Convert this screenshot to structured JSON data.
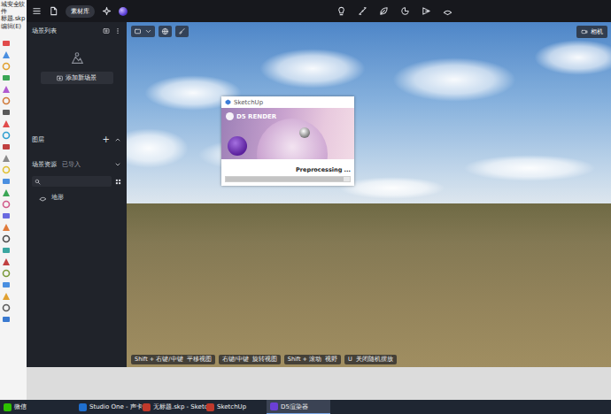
{
  "sketchup": {
    "title_lines": [
      "城安全软",
      "件",
      "标题.skp",
      "编辑(E)"
    ]
  },
  "d5": {
    "toolbar": {
      "library": "素材库"
    },
    "panel": {
      "scenes_title": "场景列表",
      "add_scene": "添加新场景",
      "layers_title": "图层",
      "layers_add": "+",
      "assets_title": "场景资源",
      "assets_filter": "已导入",
      "assets": [
        {
          "label": "地形"
        }
      ]
    },
    "viewport": {
      "camera": "相机",
      "hints": [
        {
          "key": "Shift + 右键/中键",
          "action": "平移视图"
        },
        {
          "key": "右键/中键",
          "action": "旋转视图"
        },
        {
          "key": "Shift + 滚动",
          "action": "视野"
        },
        {
          "key": "U",
          "action": "关闭随机摆放"
        }
      ]
    }
  },
  "splash": {
    "title": "SketchUp",
    "logo": "D5 RENDER",
    "status": "Preprocessing ...",
    "level": 0.95
  },
  "taskbar": {
    "items": [
      {
        "label": "微信",
        "selected": false
      },
      {
        "label": "Studio One - 声卡",
        "selected": false
      },
      {
        "label": "无标题.skp - Sketc",
        "selected": false
      },
      {
        "label": "SketchUp",
        "selected": false
      },
      {
        "label": "D5渲染器",
        "selected": true
      }
    ]
  }
}
